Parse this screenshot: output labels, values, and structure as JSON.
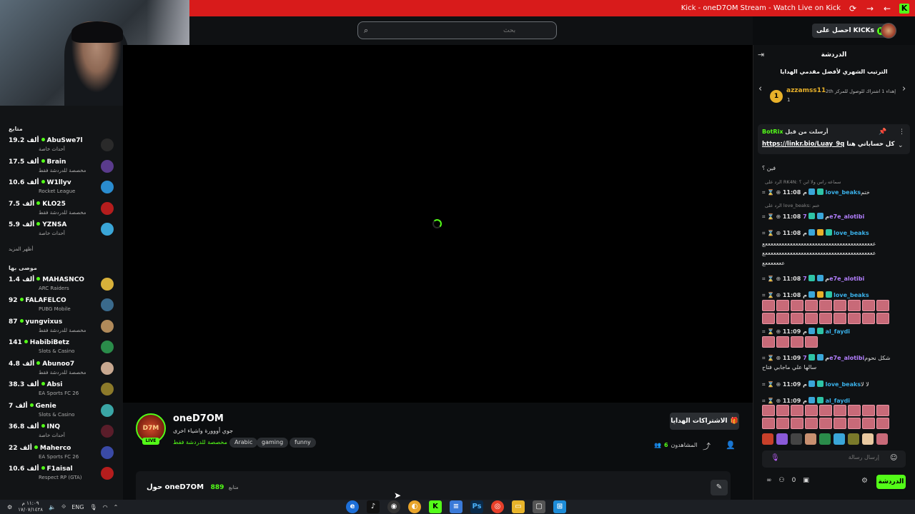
{
  "window": {
    "title": "Kick - oneD7OM Stream - Watch Live on Kick"
  },
  "search": {
    "placeholder": "بحث"
  },
  "header": {
    "get_kicks": "احصل على KICKs"
  },
  "sidebar": {
    "following_title": "متابع",
    "following": [
      {
        "name": "AbuSwe7l",
        "viewers": "19.2 ألف",
        "category": "أحداث خاصة",
        "avatar_color": "#2a2a2a"
      },
      {
        "name": "Brain",
        "viewers": "17.5 ألف",
        "category": "مخصصة للدردشة فقط",
        "avatar_color": "#5a3b8c"
      },
      {
        "name": "W1llyv",
        "viewers": "10.6 ألف",
        "category": "Rocket League",
        "avatar_color": "#2a8ccf"
      },
      {
        "name": "KLO25",
        "viewers": "7.5 ألف",
        "category": "مخصصة للدردشة فقط",
        "avatar_color": "#b51d1d"
      },
      {
        "name": "YZNSA",
        "viewers": "5.9 ألف",
        "category": "أحداث خاصة",
        "avatar_color": "#3aa6d8"
      }
    ],
    "show_more": "أظهر المزيد",
    "recommended_title": "موصى بها",
    "recommended": [
      {
        "name": "MAHASNCO",
        "viewers": "1.4 ألف",
        "category": "ARC Raiders",
        "avatar_color": "#d8b13a"
      },
      {
        "name": "FALAFELCO",
        "viewers": "92",
        "category": "PUBG Mobile",
        "avatar_color": "#3a6a8c"
      },
      {
        "name": "yungvixus",
        "viewers": "87",
        "category": "مخصصة للدردشة فقط",
        "avatar_color": "#b08a5a"
      },
      {
        "name": "HabibiBetz",
        "viewers": "141",
        "category": "Slots & Casino",
        "avatar_color": "#2a8c4a"
      },
      {
        "name": "Abunoo7",
        "viewers": "4.8 ألف",
        "category": "مخصصة للدردشة فقط",
        "avatar_color": "#c8a890"
      },
      {
        "name": "Absi",
        "viewers": "38.3 ألف",
        "category": "EA Sports FC 26",
        "avatar_color": "#8c7a2a"
      },
      {
        "name": "Genie",
        "viewers": "7 ألف",
        "category": "Slots & Casino",
        "avatar_color": "#3aa6a6"
      },
      {
        "name": "INQ",
        "viewers": "36.8 ألف",
        "category": "أحداث خاصة",
        "avatar_color": "#5a1d2a"
      },
      {
        "name": "Maherco",
        "viewers": "22 ألف",
        "category": "EA Sports FC 26",
        "avatar_color": "#3a4aa6"
      },
      {
        "name": "F1aisal",
        "viewers": "10.6 ألف",
        "category": "Respect RP (GTA)",
        "avatar_color": "#b51d1d"
      }
    ]
  },
  "stream": {
    "streamer": "oneD7OM",
    "avatar_text": "D7M",
    "live_label": "LIVE",
    "title": "جوي أووورة واشياء اخرى",
    "category": "مخصصة للدردشة فقط",
    "tags": [
      "Arabic",
      "gaming",
      "funny"
    ],
    "gift_subs": "الاشتراكات الهدايا",
    "viewers_count": "6",
    "viewers_label": "المشاهدون",
    "about_label": "حول oneD7OM",
    "followers_count": "889",
    "followers_label": "متابع"
  },
  "chat": {
    "header": "الدردشة",
    "leaderboard_title": "الترتيب الشهري لأفضل مقدمي الهدايا",
    "leader": {
      "rank": "1",
      "user": "azzamss11",
      "count": "1"
    },
    "leader_info": "إهداء 1 اشتراك للوصول للمركز 2th",
    "pinned": {
      "author_prefix": "أرسلت من قبل",
      "author": "BotRix",
      "text_prefix": "كل حساباتي هنا",
      "link": "https://linkr.bio/Luay_9q"
    },
    "messages": [
      {
        "text": "فين ؟"
      },
      {
        "reply": "الرد على RK4N: سماعه راس ولا ابن ؟"
      },
      {
        "time": "11:08 م",
        "user": "love_beaks",
        "text": "ختم"
      },
      {
        "reply": "الرد على love_beaks: ختم"
      },
      {
        "time": "11:08 م",
        "user": "7e7e_alotibi",
        "text": ""
      },
      {
        "time": "11:08 م",
        "user": "love_beaks",
        "text": ""
      },
      {
        "text": "ععععععععععععععععععععععععععععععععععععععععع"
      },
      {
        "text": "ععععععععععععععععععععععععععععععععععععععععع"
      },
      {
        "text": "عععععععع"
      },
      {
        "time": "11:08 م",
        "user": "7e7e_alotibi",
        "text": ""
      },
      {
        "time": "11:08 م",
        "user": "love_beaks",
        "text": ""
      },
      {
        "time": "11:09 م",
        "user": "al_faydi",
        "text": ""
      },
      {
        "time": "11:09 م",
        "user": "7e7e_alotibi",
        "text": "شكل نحوم"
      },
      {
        "text": "سالها علي ماجابي فتاح"
      },
      {
        "time": "11:09 م",
        "user": "love_beaks",
        "text": "لا لا"
      },
      {
        "time": "11:09 م",
        "user": "al_faydi",
        "text": ""
      }
    ],
    "input_placeholder": "إرسال رسالة",
    "send_label": "الدردشة",
    "points": "0"
  },
  "taskbar": {
    "lang": "ENG",
    "clock_time": "١١:٠٩ م",
    "clock_date": "١٧/٠٧/١٤٢٨"
  }
}
